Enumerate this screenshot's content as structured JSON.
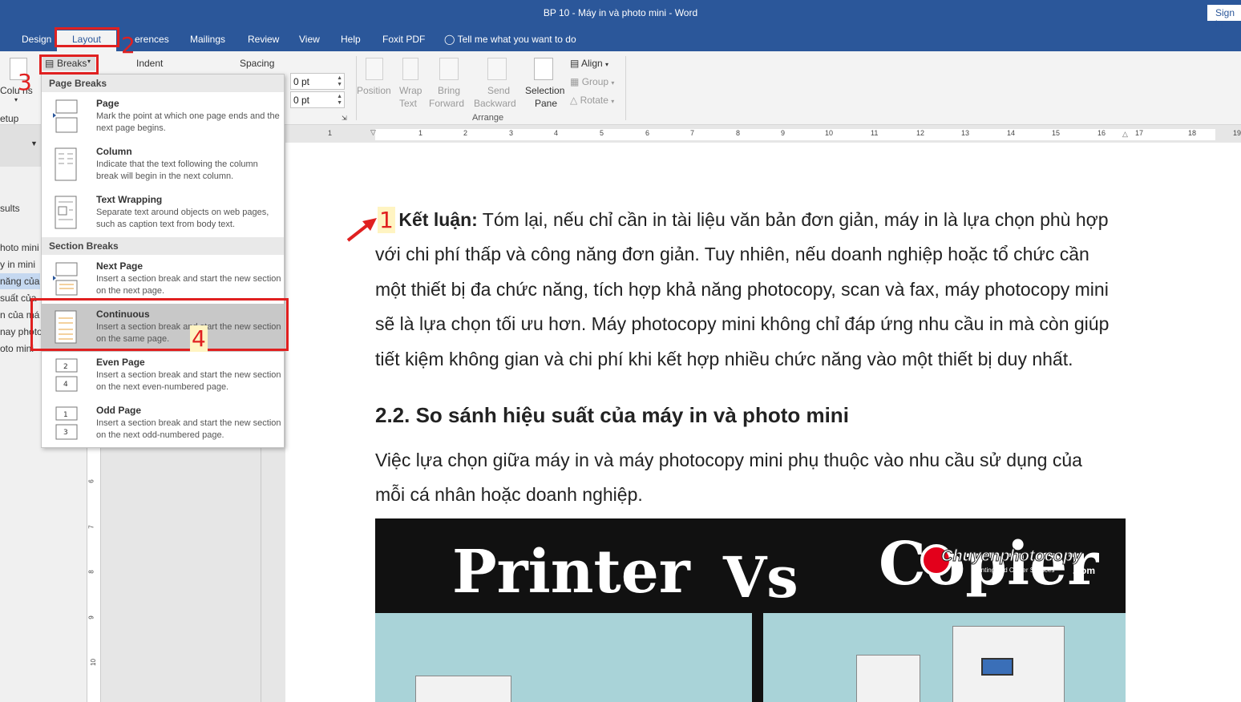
{
  "window": {
    "title": "BP 10 - Máy in và photo mini  -  Word",
    "sign_in": "Sign in"
  },
  "tabs": [
    {
      "label": "Design"
    },
    {
      "label": "Layout"
    },
    {
      "label": "erences"
    },
    {
      "label": "Mailings"
    },
    {
      "label": "Review"
    },
    {
      "label": "View"
    },
    {
      "label": "Help"
    },
    {
      "label": "Foxit PDF"
    },
    {
      "label": "Tell me what you want to do"
    }
  ],
  "ribbon": {
    "columns_label": "Colu  ns",
    "setup_label": "etup",
    "breaks_label": "Breaks",
    "indent_label": "Indent",
    "spacing_label": "Spacing",
    "spacing_before": "0 pt",
    "spacing_after": "0 pt",
    "arrange": {
      "position": "Position",
      "wrap_text_1": "Wrap",
      "wrap_text_2": "Text",
      "bring_forward_1": "Bring",
      "bring_forward_2": "Forward",
      "send_backward_1": "Send",
      "send_backward_2": "Backward",
      "selection_pane_1": "Selection",
      "selection_pane_2": "Pane",
      "align": "Align",
      "group": "Group",
      "rotate": "Rotate",
      "group_label": "Arrange"
    }
  },
  "breaks_menu": {
    "page_breaks_header": "Page Breaks",
    "section_breaks_header": "Section Breaks",
    "items": [
      {
        "title": "Page",
        "desc": "Mark the point at which one page ends and the next page begins."
      },
      {
        "title": "Column",
        "desc": "Indicate that the text following the column break will begin in the next column."
      },
      {
        "title": "Text Wrapping",
        "desc": "Separate text around objects on web pages, such as caption text from body text."
      },
      {
        "title": "Next Page",
        "desc": "Insert a section break and start the new section on the next page."
      },
      {
        "title": "Continuous",
        "desc": "Insert a section break and start the new section on the same page."
      },
      {
        "title": "Even Page",
        "desc": "Insert a section break and start the new section on the next even-numbered page."
      },
      {
        "title": "Odd Page",
        "desc": "Insert a section break and start the new section on the next odd-numbered page."
      }
    ]
  },
  "navpane": {
    "items": [
      "sults",
      "hoto mini",
      "y in mini",
      "năng của",
      "suất của",
      "n của má",
      "nay photo",
      "oto mini"
    ]
  },
  "ruler": {
    "labels": [
      "1",
      "1",
      "2",
      "3",
      "4",
      "5",
      "6",
      "7",
      "8",
      "9",
      "10",
      "11",
      "12",
      "13",
      "14",
      "15",
      "16",
      "17",
      "18",
      "19"
    ]
  },
  "vruler": {
    "labels": [
      "6",
      "7",
      "8",
      "9",
      "10"
    ]
  },
  "document": {
    "conclusion_label": "Kết luận:",
    "conclusion_lines": [
      "Tóm lại, nếu chỉ cần in tài liệu văn bản đơn giản, máy in là lựa chọn phù hợp",
      "với chi phí thấp và công năng đơn giản. Tuy nhiên, nếu doanh nghiệp hoặc tổ chức cần",
      "một thiết bị đa chức năng, tích hợp khả năng photocopy, scan và fax, máy photocopy mini",
      "sẽ là lựa chọn tối ưu hơn. Máy photocopy mini không chỉ đáp ứng nhu cầu in mà còn giúp",
      "tiết kiệm không gian và chi phí khi kết hợp nhiều chức năng vào một thiết bị duy nhất."
    ],
    "heading": "2.2. So sánh hiệu suất của máy in và photo mini",
    "para2_lines": [
      "Việc lựa chọn giữa máy in và máy photocopy mini phụ thuộc vào nhu cầu sử dụng của",
      "mỗi cá nhân hoặc doanh nghiệp."
    ],
    "image": {
      "left_text": "Printer",
      "vs_text": "Vs",
      "right_text": "Copier",
      "brand_name": "Chuyenphotocopy",
      "brand_sub": "Printing and Copier Services",
      "brand_com": ".com"
    }
  },
  "annotations": {
    "step1": "1",
    "step2": "2",
    "step3": "3",
    "step4": "4"
  },
  "colors": {
    "word_blue": "#2b579a",
    "annotation_red": "#e02020",
    "highlight_yellow": "#fff4c2"
  }
}
